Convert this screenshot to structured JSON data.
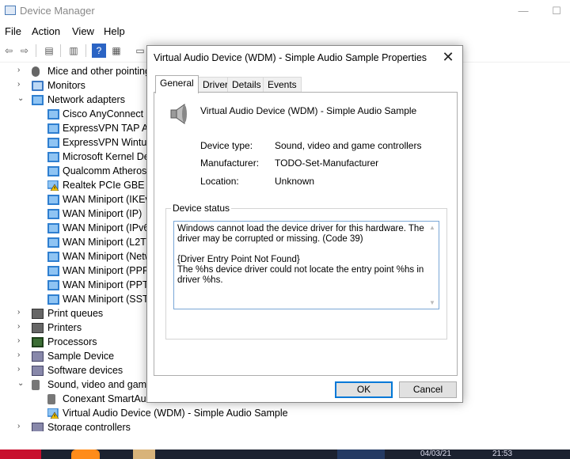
{
  "window": {
    "title": "Device Manager",
    "minimize_glyph": "—",
    "maximize_glyph": "☐"
  },
  "menu": [
    "File",
    "Action",
    "View",
    "Help"
  ],
  "tree": {
    "items": [
      {
        "label": "Mice and other pointing",
        "icon": "mouse-icon",
        "chevron": "›",
        "level": 0
      },
      {
        "label": "Monitors",
        "icon": "monitor-icon",
        "chevron": "›",
        "level": 0
      },
      {
        "label": "Network adapters",
        "icon": "network-adapter-icon",
        "chevron": "⌄",
        "level": 0
      },
      {
        "label": "Cisco AnyConnect S",
        "icon": "network-adapter-icon",
        "chevron": "",
        "level": 1
      },
      {
        "label": "ExpressVPN TAP Ada",
        "icon": "network-adapter-icon",
        "chevron": "",
        "level": 1
      },
      {
        "label": "ExpressVPN Wintun",
        "icon": "network-adapter-icon",
        "chevron": "",
        "level": 1
      },
      {
        "label": "Microsoft Kernel Deb",
        "icon": "network-adapter-icon",
        "chevron": "",
        "level": 1
      },
      {
        "label": "Qualcomm Atheros",
        "icon": "network-adapter-icon",
        "chevron": "",
        "level": 1
      },
      {
        "label": "Realtek PCIe GBE Fa",
        "icon": "warning-icon",
        "chevron": "",
        "level": 1
      },
      {
        "label": "WAN Miniport (IKEv",
        "icon": "network-adapter-icon",
        "chevron": "",
        "level": 1
      },
      {
        "label": "WAN Miniport (IP)",
        "icon": "network-adapter-icon",
        "chevron": "",
        "level": 1
      },
      {
        "label": "WAN Miniport (IPv6",
        "icon": "network-adapter-icon",
        "chevron": "",
        "level": 1
      },
      {
        "label": "WAN Miniport (L2TP",
        "icon": "network-adapter-icon",
        "chevron": "",
        "level": 1
      },
      {
        "label": "WAN Miniport (Netw",
        "icon": "network-adapter-icon",
        "chevron": "",
        "level": 1
      },
      {
        "label": "WAN Miniport (PPPO",
        "icon": "network-adapter-icon",
        "chevron": "",
        "level": 1
      },
      {
        "label": "WAN Miniport (PPTP",
        "icon": "network-adapter-icon",
        "chevron": "",
        "level": 1
      },
      {
        "label": "WAN Miniport (SSTP",
        "icon": "network-adapter-icon",
        "chevron": "",
        "level": 1
      },
      {
        "label": "Print queues",
        "icon": "printer-icon",
        "chevron": "›",
        "level": 0
      },
      {
        "label": "Printers",
        "icon": "printer-icon",
        "chevron": "›",
        "level": 0
      },
      {
        "label": "Processors",
        "icon": "processor-icon",
        "chevron": "›",
        "level": 0
      },
      {
        "label": "Sample Device",
        "icon": "device-icon",
        "chevron": "›",
        "level": 0
      },
      {
        "label": "Software devices",
        "icon": "device-icon",
        "chevron": "›",
        "level": 0
      },
      {
        "label": "Sound, video and game",
        "icon": "speaker-icon",
        "chevron": "⌄",
        "level": 0
      },
      {
        "label": "Conexant SmartAud",
        "icon": "speaker-icon",
        "chevron": "",
        "level": 1
      },
      {
        "label": "Virtual Audio Device (WDM) - Simple Audio Sample",
        "icon": "warning-icon",
        "chevron": "",
        "level": 1
      },
      {
        "label": "Storage controllers",
        "icon": "device-icon",
        "chevron": "›",
        "level": 0
      }
    ]
  },
  "dialog": {
    "title": "Virtual Audio Device (WDM) - Simple Audio Sample Properties",
    "close_glyph": "✕",
    "tabs": [
      "General",
      "Driver",
      "Details",
      "Events"
    ],
    "active_tab": "General",
    "device_name": "Virtual Audio Device (WDM) - Simple Audio Sample",
    "properties": [
      {
        "label": "Device type:",
        "value": "Sound, video and game controllers"
      },
      {
        "label": "Manufacturer:",
        "value": "TODO-Set-Manufacturer"
      },
      {
        "label": "Location:",
        "value": "Unknown"
      }
    ],
    "status_group_label": "Device status",
    "status_text": "Windows cannot load the device driver for this hardware. The driver may be corrupted or missing. (Code 39)\n\n{Driver Entry Point Not Found}\nThe %hs device driver could not locate the entry point %hs in driver %hs.",
    "ok_label": "OK",
    "cancel_label": "Cancel"
  },
  "taskbar": {
    "date": "04/03/21",
    "time": "21:53"
  },
  "colors": {
    "accent": "#0078d7",
    "taskbar": "#1c2230",
    "warning": "#f5c400"
  }
}
